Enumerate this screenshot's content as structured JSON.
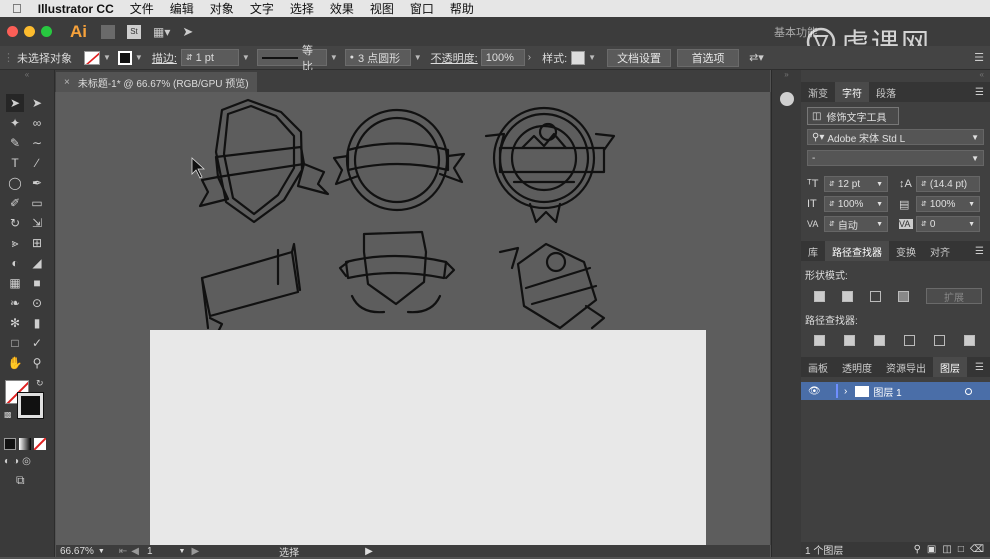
{
  "menubar": {
    "app_name": "Illustrator CC",
    "items": [
      "文件",
      "编辑",
      "对象",
      "文字",
      "选择",
      "效果",
      "视图",
      "窗口",
      "帮助"
    ]
  },
  "appbar": {
    "logo": "Ai",
    "workspace": "基本功能",
    "watermark": "虎课网"
  },
  "controlbar": {
    "selection": "未选择对象",
    "stroke_label": "描边:",
    "stroke_value": "1 pt",
    "profile": "等比",
    "brush": "3 点圆形",
    "opacity_label": "不透明度:",
    "opacity_value": "100%",
    "style_label": "样式:",
    "doc_setup": "文档设置",
    "preferences": "首选项"
  },
  "document": {
    "tab_title": "未标题-1* @ 66.67% (RGB/GPU 预览)"
  },
  "status": {
    "zoom": "66.67%",
    "page": "1",
    "tool": "选择"
  },
  "character_panel": {
    "tabs": [
      "渐变",
      "字符",
      "段落"
    ],
    "touch_type": "修饰文字工具",
    "font_family": "Adobe 宋体 Std L",
    "font_style": "-",
    "font_size": "12 pt",
    "leading": "(14.4 pt)",
    "vscale": "100%",
    "hscale": "100%",
    "kerning": "自动",
    "tracking": "0"
  },
  "pathfinder_panel": {
    "tabs": [
      "库",
      "路径查找器",
      "变换",
      "对齐"
    ],
    "shape_modes": "形状模式:",
    "expand": "扩展",
    "pathfinders": "路径查找器:"
  },
  "layers_panel": {
    "tabs": [
      "画板",
      "透明度",
      "资源导出",
      "图层"
    ],
    "layers": [
      {
        "name": "图层 1"
      }
    ],
    "footer": "1 个图层"
  },
  "colors": {
    "accent": "#4a6ea8"
  }
}
